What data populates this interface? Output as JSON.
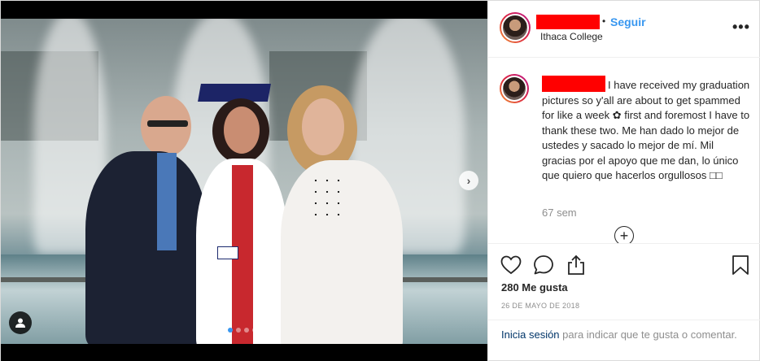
{
  "post": {
    "header": {
      "username_redacted": true,
      "separator": "•",
      "follow_label": "Seguir",
      "location": "Ithaca College",
      "more_icon": "more-options-icon"
    },
    "caption": {
      "username_redacted": true,
      "text": "I have received my graduation pictures so y'all are about to get spammed for like a week ✿ first and foremost I have to thank these two. Me han dado lo mejor de ustedes y sacado lo mejor de mí. Mil gracias por el apoyo que me dan, lo único que quiero que hacerlos orgullosos □□"
    },
    "time_ago": "67 sem",
    "load_more_icon": "plus-circle-icon",
    "actions": {
      "like_icon": "heart-icon",
      "comment_icon": "comment-icon",
      "share_icon": "share-icon",
      "save_icon": "bookmark-icon"
    },
    "likes": "280 Me gusta",
    "date": "26 DE MAYO DE 2018",
    "login_prompt": {
      "link": "Inicia sesión",
      "rest": " para indicar que te gusta o comentar."
    },
    "carousel": {
      "slide_count": 4,
      "active_index": 0,
      "next_icon": "chevron-right-icon",
      "tag_icon": "user-tag-icon"
    },
    "colors": {
      "accent": "#3897f0",
      "redaction": "#ff0000",
      "muted": "#8e8e8e",
      "text": "#262626"
    }
  }
}
